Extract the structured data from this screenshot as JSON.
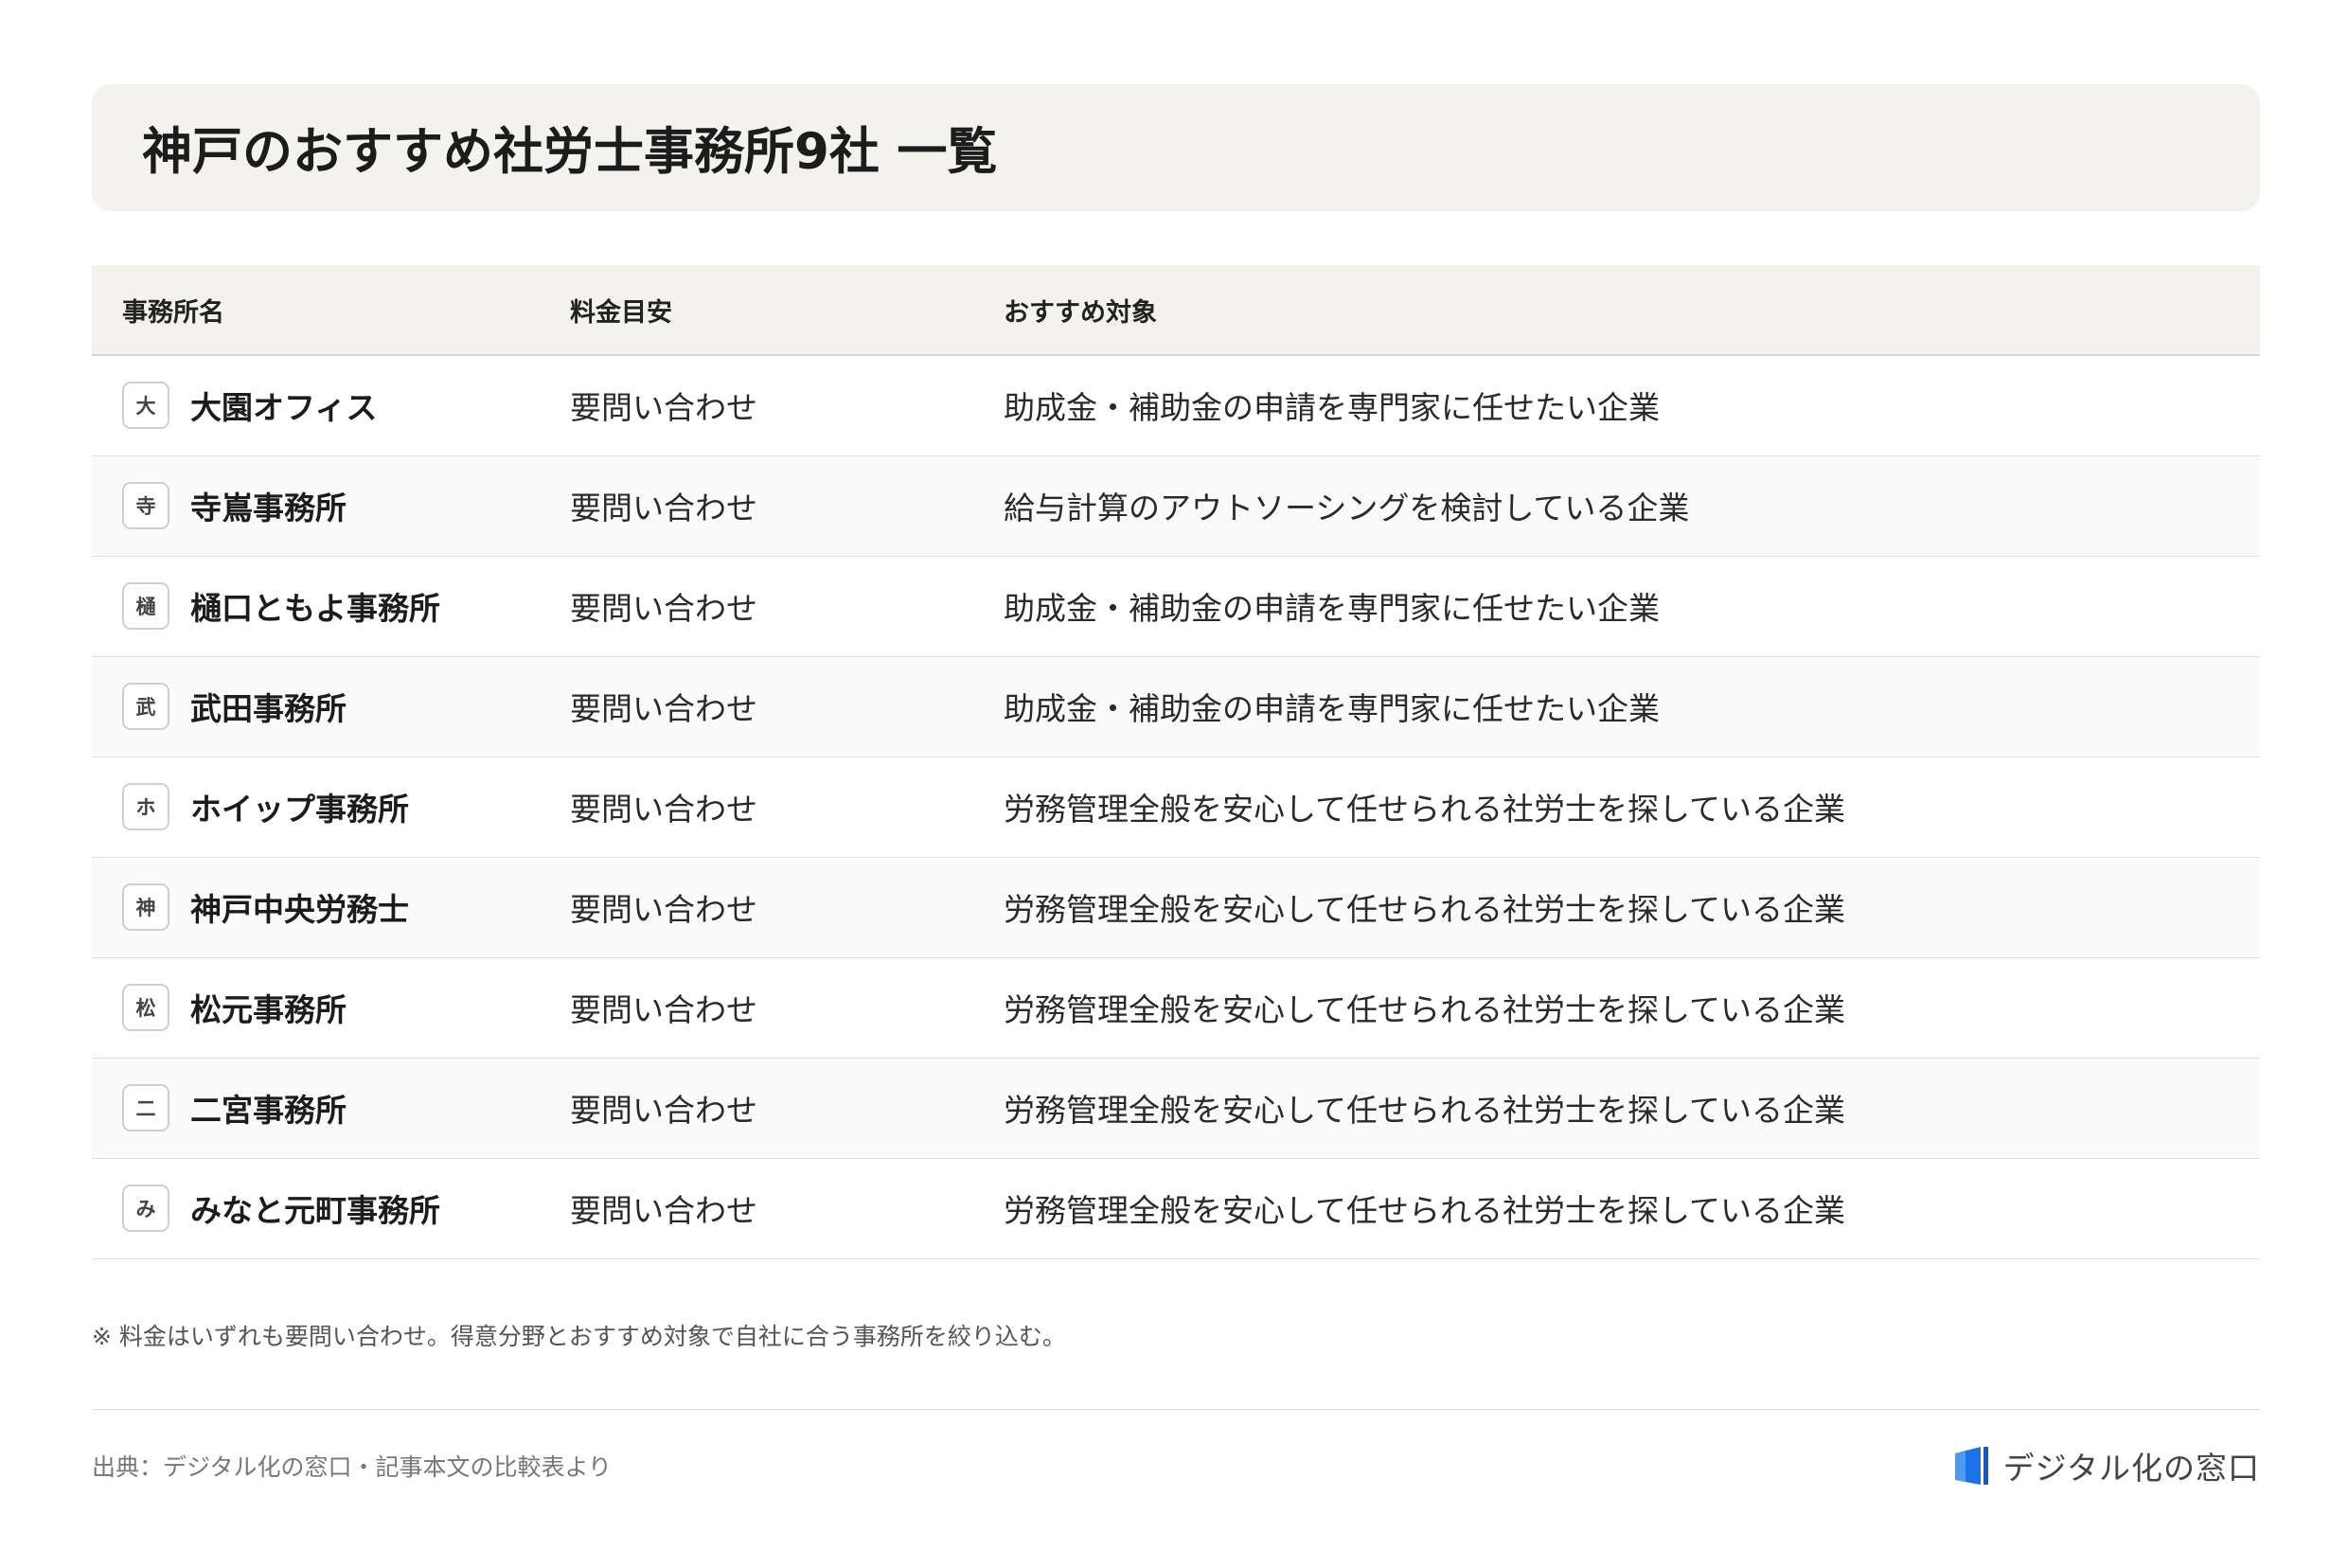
{
  "title": "神戸のおすすめ社労士事務所9社 一覧",
  "table": {
    "headers": [
      "事務所名",
      "料金目安",
      "おすすめ対象"
    ],
    "rows": [
      {
        "badge": "大",
        "name": "大園オフィス",
        "fee": "要問い合わせ",
        "target": "助成金・補助金の申請を専門家に任せたい企業"
      },
      {
        "badge": "寺",
        "name": "寺嶌事務所",
        "fee": "要問い合わせ",
        "target": "給与計算のアウトソーシングを検討している企業"
      },
      {
        "badge": "樋",
        "name": "樋口ともよ事務所",
        "fee": "要問い合わせ",
        "target": "助成金・補助金の申請を専門家に任せたい企業"
      },
      {
        "badge": "武",
        "name": "武田事務所",
        "fee": "要問い合わせ",
        "target": "助成金・補助金の申請を専門家に任せたい企業"
      },
      {
        "badge": "ホ",
        "name": "ホイップ事務所",
        "fee": "要問い合わせ",
        "target": "労務管理全般を安心して任せられる社労士を探している企業"
      },
      {
        "badge": "神",
        "name": "神戸中央労務士",
        "fee": "要問い合わせ",
        "target": "労務管理全般を安心して任せられる社労士を探している企業"
      },
      {
        "badge": "松",
        "name": "松元事務所",
        "fee": "要問い合わせ",
        "target": "労務管理全般を安心して任せられる社労士を探している企業"
      },
      {
        "badge": "二",
        "name": "二宮事務所",
        "fee": "要問い合わせ",
        "target": "労務管理全般を安心して任せられる社労士を探している企業"
      },
      {
        "badge": "み",
        "name": "みなと元町事務所",
        "fee": "要問い合わせ",
        "target": "労務管理全般を安心して任せられる社労士を探している企業"
      }
    ]
  },
  "note": "※ 料金はいずれも要問い合わせ。得意分野とおすすめ対象で自社に合う事務所を絞り込む。",
  "footer": {
    "source": "出典：デジタル化の窓口・記事本文の比較表より",
    "brand": "デジタル化の窓口",
    "brand_icon": "window-logo-icon",
    "brand_color": "#1a73e8"
  }
}
